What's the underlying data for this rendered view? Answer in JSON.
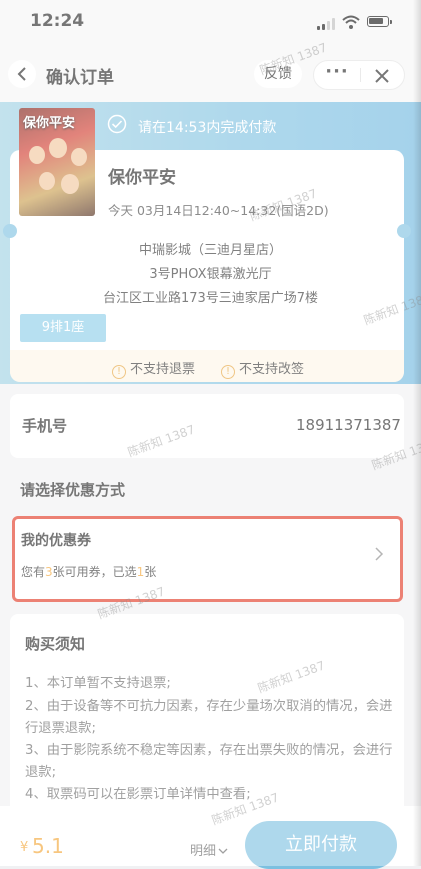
{
  "status_bar": {
    "time": "12:24"
  },
  "nav": {
    "title": "确认订单",
    "feedback": "反馈",
    "more": "···"
  },
  "payment_tip": "请在14:53内完成付款",
  "movie": {
    "poster_title": "保你平安",
    "name": "保你平安",
    "showtime": "今天 03月14日12:40~14:32(国语2D)",
    "cinema": "中瑞影城（三迪月星店）",
    "hall": "3号PHOX银幕激光厅",
    "address": "台江区工业路173号三迪家居广场7楼",
    "seat": "9排1座",
    "notices": [
      "不支持退票",
      "不支持改签"
    ]
  },
  "phone": {
    "label": "手机号",
    "value": "18911371387"
  },
  "discount": {
    "section_title": "请选择优惠方式",
    "coupon_title": "我的优惠券",
    "desc_prefix": "您有",
    "available_count": "3",
    "desc_middle": "张可用券，已选",
    "selected_count": "1",
    "desc_suffix": "张"
  },
  "rules": {
    "title": "购买须知",
    "items": [
      "1、本订单暂不支持退票;",
      "2、由于设备等不可抗力因素，存在少量场次取消的情况，会进行退票退款;",
      "3、由于影院系统不稳定等因素，存在出票失败的情况，会进行退款;",
      "4、取票码可以在影票订单详情中查看;"
    ]
  },
  "footer": {
    "currency": "¥",
    "price": "5.1",
    "detail": "明细",
    "pay": "立即付款"
  },
  "watermark": "陈新知 1387",
  "colors": {
    "accent": "#7cc0e0",
    "price": "#f3a431",
    "highlight_border": "#e0341f"
  }
}
